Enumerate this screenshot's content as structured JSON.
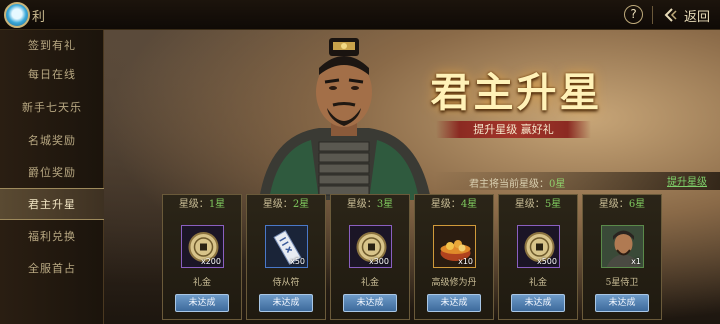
{
  "header": {
    "title_fragment": "利",
    "help_label": "?",
    "back_label": "返回"
  },
  "sidebar": {
    "items": [
      {
        "label": "签到有礼"
      },
      {
        "label": "每日在线"
      },
      {
        "label": "新手七天乐"
      },
      {
        "label": "名城奖励"
      },
      {
        "label": "爵位奖励"
      },
      {
        "label": "君主升星"
      },
      {
        "label": "福利兑换"
      },
      {
        "label": "全服首占"
      }
    ],
    "active_index": 5
  },
  "banner": {
    "title": "君主升星",
    "subtitle": "提升星级 赢好礼"
  },
  "status": {
    "current_prefix": "君主将当前星级：",
    "current_value": "0星",
    "upgrade_link": "提升星级"
  },
  "cards": [
    {
      "level_label": "星级：",
      "level": "1星",
      "item": "礼金",
      "qty": "x200",
      "button": "未达成",
      "icon": "coin-icon"
    },
    {
      "level_label": "星级：",
      "level": "2星",
      "item": "侍从符",
      "qty": "x50",
      "button": "未达成",
      "icon": "talisman-icon"
    },
    {
      "level_label": "星级：",
      "level": "3星",
      "item": "礼金",
      "qty": "x300",
      "button": "未达成",
      "icon": "coin-icon"
    },
    {
      "level_label": "星级：",
      "level": "4星",
      "item": "高级修为丹",
      "qty": "x10",
      "button": "未达成",
      "icon": "pill-bowl-icon"
    },
    {
      "level_label": "星级：",
      "level": "5星",
      "item": "礼金",
      "qty": "x500",
      "button": "未达成",
      "icon": "coin-icon"
    },
    {
      "level_label": "星级：",
      "level": "6星",
      "item": "5星侍卫",
      "qty": "x1",
      "button": "未达成",
      "icon": "guard-portrait-icon"
    }
  ],
  "colors": {
    "accent_green": "#7fc95e",
    "button_blue": "#4f7fb4",
    "ribbon_red": "#a3352a",
    "title_gold": "#fff2b8"
  }
}
